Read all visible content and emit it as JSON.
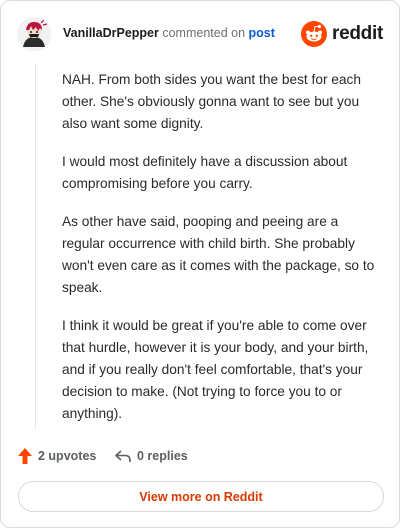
{
  "header": {
    "username": "VanillaDrPepper",
    "commented_text": "commented on",
    "post_link": "post",
    "brand": "reddit"
  },
  "colors": {
    "accent": "#ff4500",
    "link": "#0a5bd6",
    "view_more": "#d93a00"
  },
  "comment": {
    "paragraphs": [
      "NAH. From both sides you want the best for each other. She's obviously gonna want to see but you also want some dignity.",
      "I would most definitely have a discussion about compromising before you carry.",
      "As other have said, pooping and peeing are a regular occurrence with child birth. She probably won't even care as it comes with the package, so to speak.",
      "I think it would be great if you're able to come over that hurdle, however it is your body, and your birth, and if you really don't feel comfortable, that's your decision to make. (Not trying to force you to or anything)."
    ]
  },
  "actions": {
    "upvotes": "2 upvotes",
    "replies": "0 replies"
  },
  "view_more_label": "View more on Reddit",
  "icons": [
    "avatar",
    "reddit-logo-icon",
    "upvote-arrow-icon",
    "reply-icon"
  ]
}
